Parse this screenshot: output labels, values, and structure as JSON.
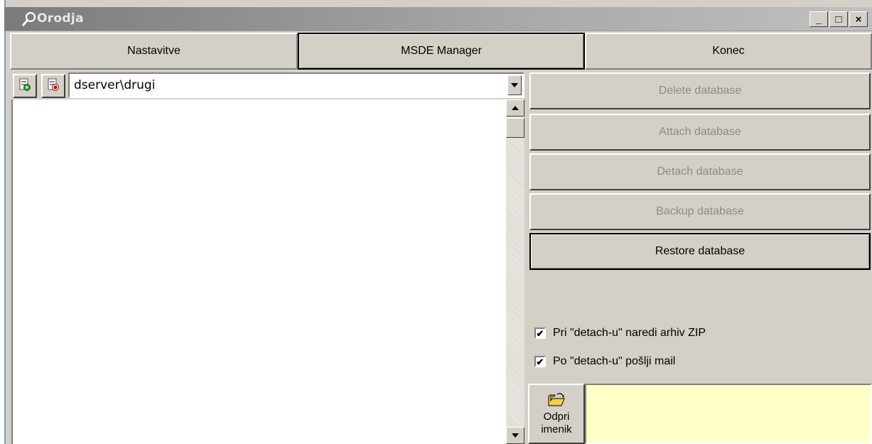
{
  "window": {
    "title": "Orodja",
    "controls": {
      "minimize": "_",
      "maximize": "□",
      "close": "×"
    }
  },
  "tabs": [
    {
      "label": "Nastavitve",
      "active": false
    },
    {
      "label": "MSDE Manager",
      "active": true
    },
    {
      "label": "Konec",
      "active": false
    }
  ],
  "server_combo": {
    "value": "dserver\\drugi"
  },
  "actions": [
    {
      "label": "Delete database",
      "enabled": false
    },
    {
      "label": "Attach database",
      "enabled": false
    },
    {
      "label": "Detach database",
      "enabled": false
    },
    {
      "label": "Backup database",
      "enabled": false
    },
    {
      "label": "Restore database",
      "enabled": true
    }
  ],
  "options": [
    {
      "label": "Pri \"detach-u\" naredi arhiv ZIP",
      "checked": true
    },
    {
      "label": "Po \"detach-u\" pošlji mail",
      "checked": true
    }
  ],
  "folder_button": {
    "line1": "Odpri",
    "line2": "imenik"
  },
  "colors": {
    "path_box": "#ffffc8",
    "face": "#d4d0c8"
  }
}
